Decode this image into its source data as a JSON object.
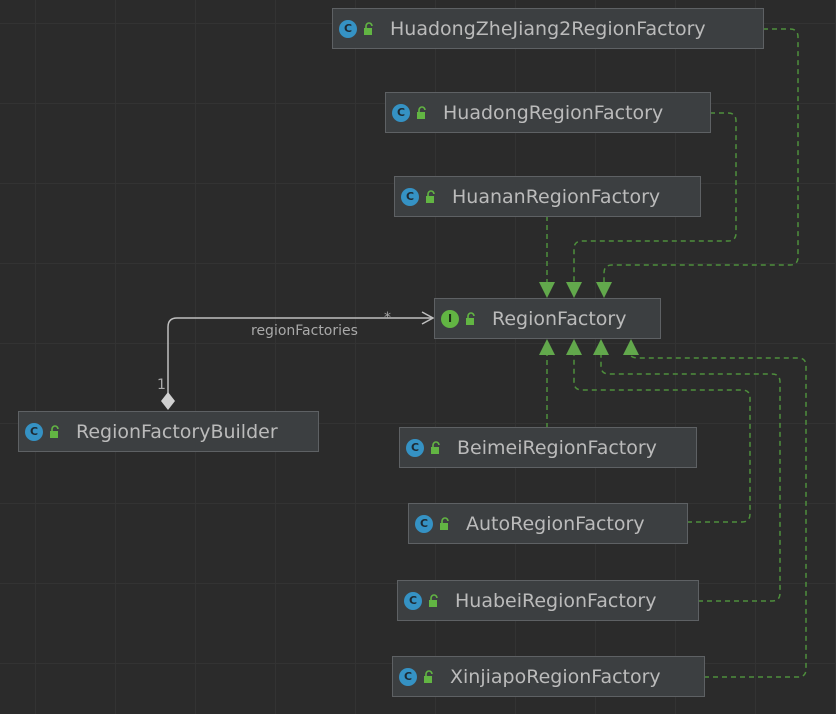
{
  "diagram": {
    "nodes": [
      {
        "id": "huadong-zhejiang2",
        "label": "HuadongZheJiang2RegionFactory",
        "kind": "class"
      },
      {
        "id": "huadong",
        "label": "HuadongRegionFactory",
        "kind": "class"
      },
      {
        "id": "huanan",
        "label": "HuananRegionFactory",
        "kind": "class"
      },
      {
        "id": "region-factory",
        "label": "RegionFactory",
        "kind": "interface"
      },
      {
        "id": "region-factory-builder",
        "label": "RegionFactoryBuilder",
        "kind": "class"
      },
      {
        "id": "beimei",
        "label": "BeimeiRegionFactory",
        "kind": "class"
      },
      {
        "id": "auto",
        "label": "AutoRegionFactory",
        "kind": "class"
      },
      {
        "id": "huabei",
        "label": "HuabeiRegionFactory",
        "kind": "class"
      },
      {
        "id": "xinjiapo",
        "label": "XinjiapoRegionFactory",
        "kind": "class"
      }
    ],
    "icons": {
      "class": {
        "glyph": "C",
        "color": "#3592c4"
      },
      "interface": {
        "glyph": "I",
        "color": "#62b543"
      },
      "visibility": "open-lock-icon"
    },
    "relations": [
      {
        "type": "implements",
        "from": "huanan",
        "to": "region-factory"
      },
      {
        "type": "implements",
        "from": "huadong",
        "to": "region-factory"
      },
      {
        "type": "implements",
        "from": "huadong-zhejiang2",
        "to": "region-factory"
      },
      {
        "type": "implements",
        "from": "beimei",
        "to": "region-factory"
      },
      {
        "type": "implements",
        "from": "auto",
        "to": "region-factory"
      },
      {
        "type": "implements",
        "from": "huabei",
        "to": "region-factory"
      },
      {
        "type": "implements",
        "from": "xinjiapo",
        "to": "region-factory"
      },
      {
        "type": "aggregation",
        "from": "region-factory-builder",
        "to": "region-factory",
        "label": "regionFactories",
        "source_multiplicity": "1",
        "target_multiplicity": "*"
      }
    ],
    "colors": {
      "background": "#2b2b2b",
      "node_fill": "#3c3f41",
      "node_border": "#5e6164",
      "node_text": "#bbbbbb",
      "implements_edge": "#4e8f3c",
      "implements_arrow": "#62a84c",
      "association_edge": "#bfbfbf"
    }
  }
}
